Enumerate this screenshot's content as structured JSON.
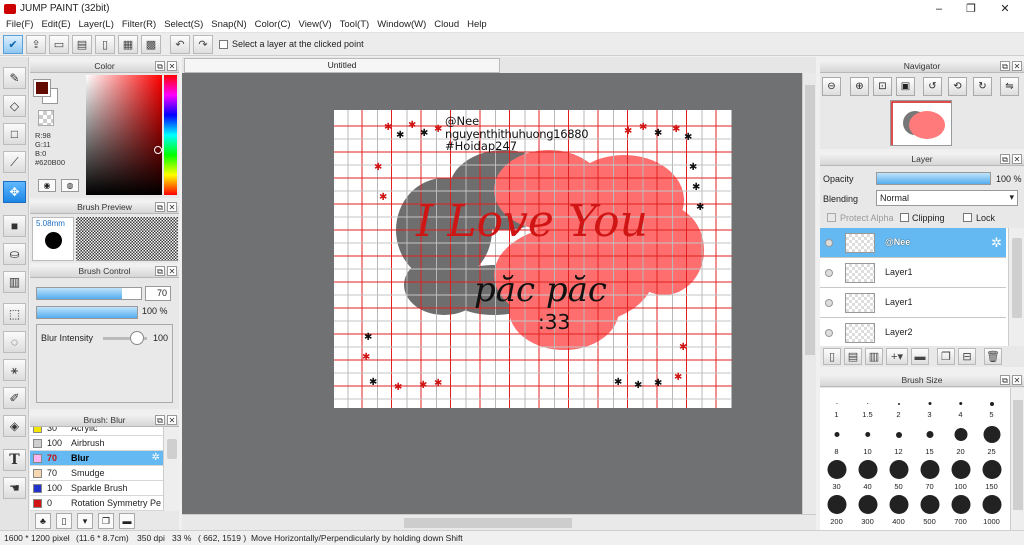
{
  "window": {
    "title": "JUMP PAINT (32bit)",
    "minimize": "–",
    "maximize": "❐",
    "close": "✕"
  },
  "menu": [
    "File(F)",
    "Edit(E)",
    "Layer(L)",
    "Filter(R)",
    "Select(S)",
    "Snap(N)",
    "Color(C)",
    "View(V)",
    "Tool(T)",
    "Window(W)",
    "Cloud",
    "Help"
  ],
  "toolbar": {
    "select_layer_label": "Select a layer at the clicked point"
  },
  "color": {
    "title": "Color",
    "r": "R:98",
    "g": "G:11",
    "b": "B:0",
    "hex": "#620B00",
    "foreground": "#620b00",
    "background": "#ffffff"
  },
  "brush_preview": {
    "title": "Brush Preview",
    "size": "5.08mm"
  },
  "brush_control": {
    "title": "Brush Control",
    "size_value": "70",
    "opacity_value": "100 %",
    "size_fill": 0.82,
    "opacity_fill": 1.0,
    "blur_label": "Blur Intensity",
    "blur_value": "100"
  },
  "brush_list": {
    "title": "Brush: Blur",
    "items": [
      {
        "num": "30",
        "name": "Acrylic",
        "color": "#f2e600",
        "selected": false
      },
      {
        "num": "100",
        "name": "Airbrush",
        "color": "#cfcfcf",
        "selected": false
      },
      {
        "num": "70",
        "name": "Blur",
        "color": "#ffb3f0",
        "selected": true
      },
      {
        "num": "70",
        "name": "Smudge",
        "color": "#f5d7b0",
        "selected": false
      },
      {
        "num": "100",
        "name": "Sparkle Brush",
        "color": "#2233cc",
        "selected": false
      },
      {
        "num": "0",
        "name": "Rotation Symmetry Pe",
        "color": "#d21414",
        "selected": false
      }
    ]
  },
  "canvas": {
    "tab": "Untitled",
    "text_lines": [
      "@Nee",
      "nguyenthithuhuong16880",
      "#Hoidap247"
    ],
    "script_line1": "I Love You",
    "script_line2": "păc păc",
    "script_line3": ":33"
  },
  "navigator": {
    "title": "Navigator"
  },
  "layer": {
    "title": "Layer",
    "opacity_label": "Opacity",
    "opacity_value": "100 %",
    "blending_label": "Blending",
    "blending_value": "Normal",
    "protect_alpha": "Protect Alpha",
    "clipping": "Clipping",
    "lock": "Lock",
    "layers": [
      {
        "name": "@Nee",
        "selected": true
      },
      {
        "name": "Layer1",
        "selected": false
      },
      {
        "name": "Layer1",
        "selected": false
      },
      {
        "name": "Layer2",
        "selected": false
      }
    ]
  },
  "brush_size": {
    "title": "Brush Size",
    "sizes": [
      "1",
      "1.5",
      "2",
      "3",
      "4",
      "5",
      "8",
      "10",
      "12",
      "15",
      "20",
      "25",
      "30",
      "40",
      "50",
      "70",
      "100",
      "150",
      "200",
      "300",
      "400",
      "500",
      "700",
      "1000"
    ]
  },
  "status": {
    "image_size": "1600 * 1200 pixel",
    "physical": "(11.6 * 8.7cm)",
    "dpi": "350 dpi",
    "zoom": "33 %",
    "coords": "( 662, 1519 )",
    "hint": "Move Horizontally/Perpendicularly by holding down Shift"
  }
}
